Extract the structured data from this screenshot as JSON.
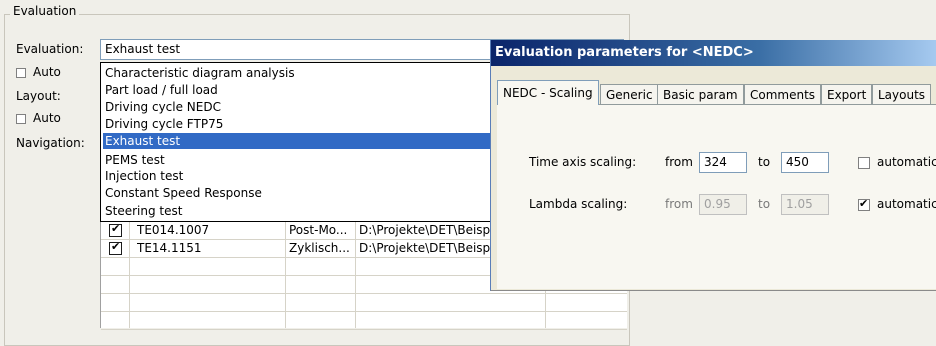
{
  "group": {
    "title": "Evaluation"
  },
  "left_labels": {
    "evaluation": "Evaluation:",
    "auto1": "Auto",
    "layout": "Layout:",
    "auto2": "Auto",
    "navigation": "Navigation:"
  },
  "evaluation_combo": {
    "value": "Exhaust test"
  },
  "dropdown": {
    "items": [
      "Characteristic diagram analysis",
      "Part load / full load",
      "Driving cycle NEDC",
      "Driving cycle FTP75",
      "Exhaust test",
      "PEMS test",
      "Injection test",
      "Constant Speed Response",
      "Steering test"
    ],
    "selected": "Exhaust test"
  },
  "grid": {
    "rows": [
      {
        "checked": true,
        "name": "TE014.1007",
        "type": "Post-Mo...",
        "path": "D:\\Projekte\\DET\\Beisp"
      },
      {
        "checked": true,
        "name": "TE14.1151",
        "type": "Zyklisch...",
        "path": "D:\\Projekte\\DET\\Beisp"
      }
    ]
  },
  "dialog": {
    "title": "Evaluation parameters for <NEDC>",
    "tabs": [
      "NEDC - Scaling",
      "Generic",
      "Basic param",
      "Comments",
      "Export",
      "Layouts"
    ],
    "active_tab": "NEDC - Scaling",
    "time_axis": {
      "label": "Time axis scaling:",
      "from_label": "from",
      "from": "324",
      "to_label": "to",
      "to": "450",
      "auto_label": "automatic",
      "auto_checked": false
    },
    "lambda": {
      "label": "Lambda scaling:",
      "from_label": "from",
      "from": "0.95",
      "to_label": "to",
      "to": "1.05",
      "auto_label": "automatic",
      "auto_checked": true
    }
  }
}
